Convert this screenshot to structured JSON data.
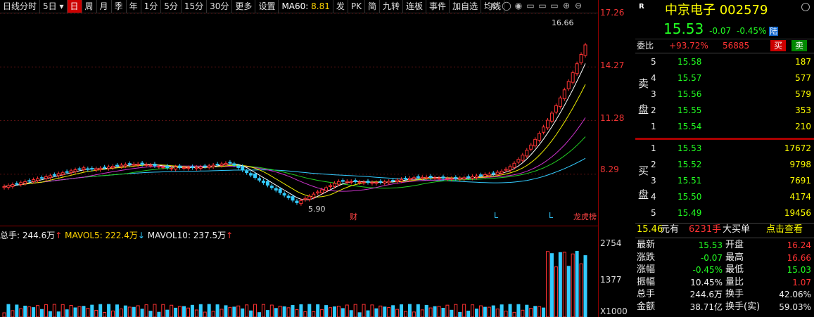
{
  "toolbar": {
    "items": [
      "日线分时",
      "5日",
      "日",
      "周",
      "月",
      "季",
      "年",
      "1分",
      "5分",
      "15分",
      "30分",
      "更多",
      "设置"
    ],
    "ma60_label": "MA60:",
    "ma60_value": "8.81",
    "items2": [
      "发",
      "PK",
      "简",
      "九转",
      "连板",
      "事件",
      "加自选",
      "均线"
    ]
  },
  "chart": {
    "y_labels": [
      "17.26",
      "14.27",
      "11.28",
      "8.29"
    ],
    "high_label": "16.66",
    "low_label": "5.90",
    "markers": [
      "财",
      "L",
      "L",
      "龙虎榜"
    ]
  },
  "volume": {
    "header_total_label": "总手: ",
    "header_total": "244.6万",
    "header_ma5": "MAVOL5: 222.4万",
    "header_ma10": "MAVOL10: 237.5万",
    "y_labels": [
      "2754",
      "1377"
    ],
    "unit": "X1000"
  },
  "chart_data": {
    "type": "candlestick",
    "y_ticks": [
      17.26,
      14.27,
      11.28,
      8.29
    ],
    "high": 16.66,
    "low": 5.9,
    "volume_ticks": [
      2754,
      1377
    ],
    "volume_unit": "X1000"
  },
  "stock": {
    "r_label": "R",
    "name": "中京电子",
    "code": "002579",
    "price": "15.53",
    "change": "-0.07",
    "change_pct": "-0.45%",
    "market_badge": "陆",
    "weibi_label": "委比",
    "weibi_value": "+93.72%",
    "weicha_value": "56885",
    "buy_btn": "买",
    "sell_btn": "卖",
    "sell_label_1": "卖",
    "sell_label_2": "盘",
    "buy_label_1": "买",
    "buy_label_2": "盘",
    "asks": [
      {
        "lvl": "5",
        "price": "15.58",
        "vol": "187"
      },
      {
        "lvl": "4",
        "price": "15.57",
        "vol": "577"
      },
      {
        "lvl": "3",
        "price": "15.56",
        "vol": "579"
      },
      {
        "lvl": "2",
        "price": "15.55",
        "vol": "353"
      },
      {
        "lvl": "1",
        "price": "15.54",
        "vol": "210"
      }
    ],
    "bids": [
      {
        "lvl": "1",
        "price": "15.53",
        "vol": "17672"
      },
      {
        "lvl": "2",
        "price": "15.52",
        "vol": "9798"
      },
      {
        "lvl": "3",
        "price": "15.51",
        "vol": "7691"
      },
      {
        "lvl": "4",
        "price": "15.50",
        "vol": "4174"
      },
      {
        "lvl": "5",
        "price": "15.49",
        "vol": "19456"
      }
    ],
    "big_order_price": "15.46",
    "big_order_unit": "元有",
    "big_order_vol": "6231手",
    "big_order_text": "大买单",
    "big_order_link": "点击查看",
    "stats": [
      {
        "l1": "最新",
        "v1": "15.53",
        "c1": "green",
        "l2": "开盘",
        "v2": "16.24",
        "c2": "red"
      },
      {
        "l1": "涨跌",
        "v1": "-0.07",
        "c1": "green",
        "l2": "最高",
        "v2": "16.66",
        "c2": "red"
      },
      {
        "l1": "涨幅",
        "v1": "-0.45%",
        "c1": "green",
        "l2": "最低",
        "v2": "15.03",
        "c2": "green"
      },
      {
        "l1": "振幅",
        "v1": "10.45%",
        "c1": "white",
        "l2": "量比",
        "v2": "1.07",
        "c2": "red"
      },
      {
        "l1": "总手",
        "v1": "244.6万",
        "c1": "white",
        "l2": "换手",
        "v2": "42.06%",
        "c2": "white"
      },
      {
        "l1": "金额",
        "v1": "38.71亿",
        "c1": "white",
        "l2": "换手(实)",
        "v2": "59.03%",
        "c2": "white"
      }
    ]
  }
}
